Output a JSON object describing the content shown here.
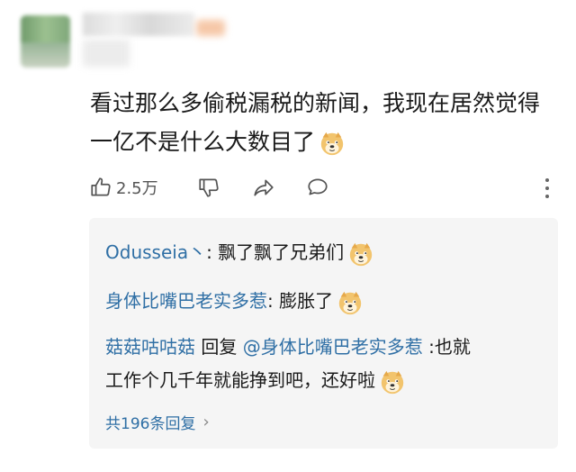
{
  "comment": {
    "line1": "看过那么多偷税漏税的新闻，我现在居然觉得",
    "line2": "一亿不是什么大数目了",
    "emoji": "doge-emoji"
  },
  "actions": {
    "like_count": "2.5万",
    "icons": [
      "thumbs-up-icon",
      "thumbs-down-icon",
      "share-icon",
      "comment-icon",
      "more-icon"
    ]
  },
  "replies": [
    {
      "user": "Odusseia丶",
      "sep": ": ",
      "text": "飘了飘了兄弟们",
      "emoji": "doge-emoji"
    },
    {
      "user": "身体比嘴巴老实多惹",
      "sep": ": ",
      "text": "膨胀了",
      "emoji": "doge-emoji"
    },
    {
      "user": "菇菇咕咕菇",
      "reply_word": " 回复 ",
      "mention": "@身体比嘴巴老实多惹",
      "sep": " :",
      "text_line1": "也就",
      "text_line2": "工作个几千年就能挣到吧，还好啦",
      "emoji": "doge-emoji"
    }
  ],
  "reply_summary": {
    "label": "共196条回复",
    "chevron": "›"
  },
  "colors": {
    "link": "#2f6fa5",
    "reply_bg": "#f5f5f5",
    "icon": "#555555"
  }
}
